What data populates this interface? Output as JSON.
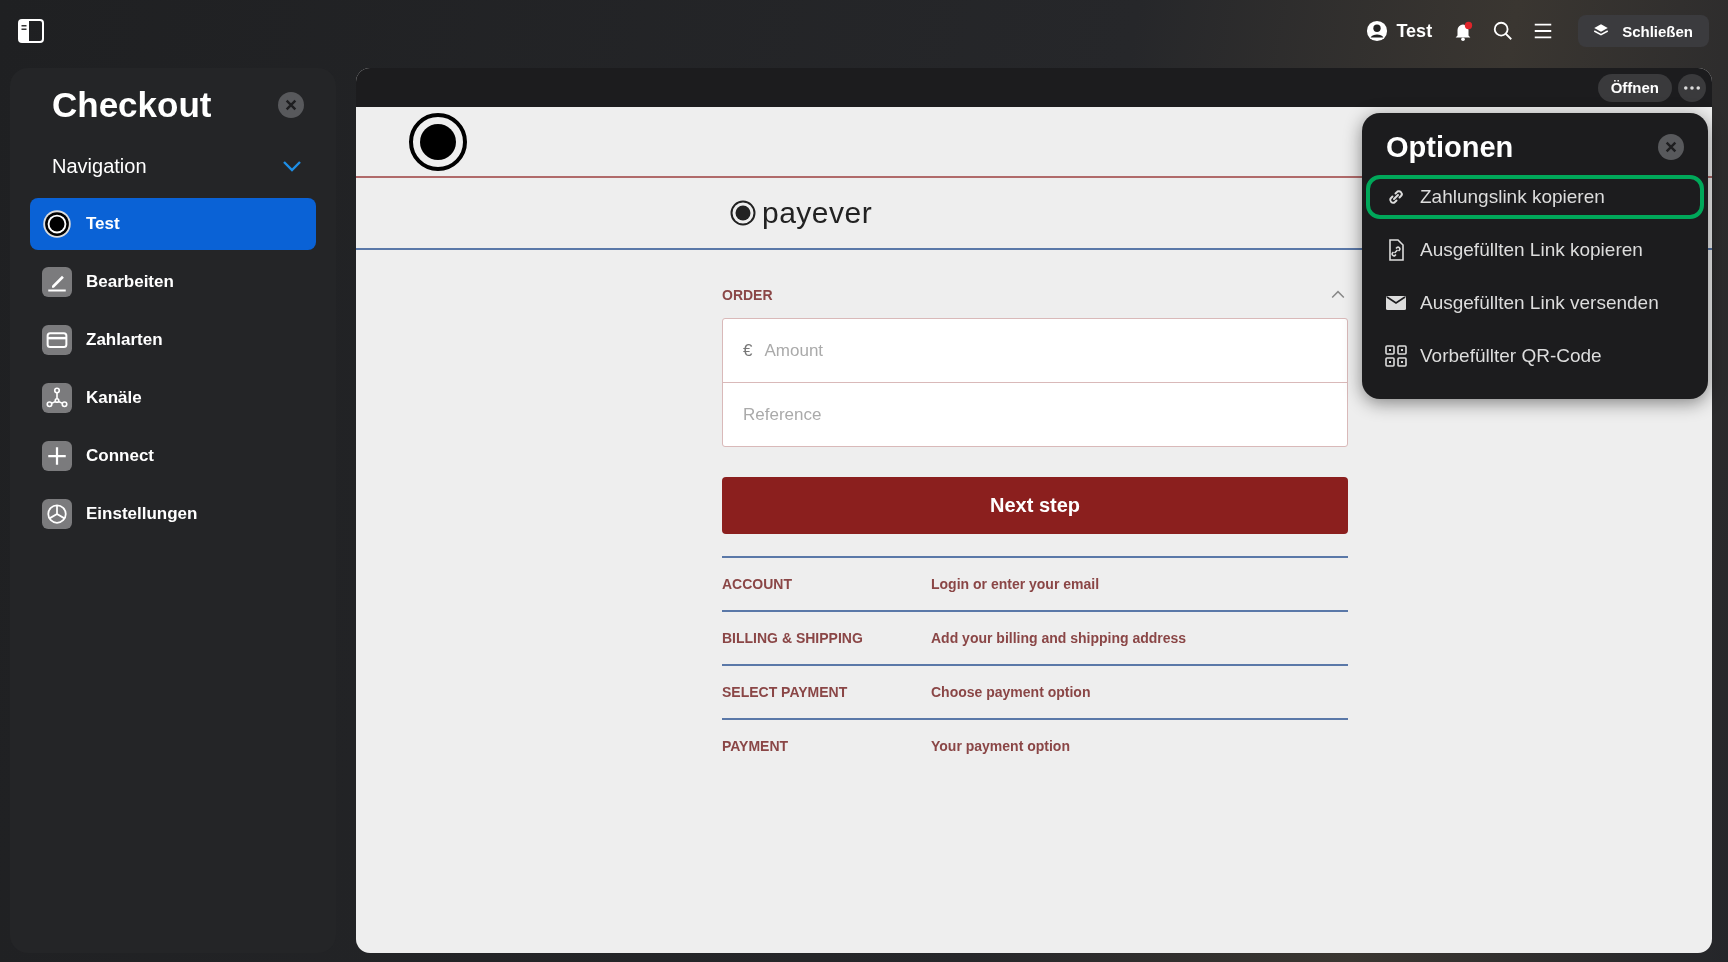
{
  "topbar": {
    "user": "Test",
    "close_button": "Schließen"
  },
  "sidebar": {
    "title": "Checkout",
    "section": "Navigation",
    "expanded": true,
    "items": [
      {
        "label": "Test",
        "kind": "logo",
        "selected": true
      },
      {
        "label": "Bearbeiten",
        "kind": "edit",
        "selected": false
      },
      {
        "label": "Zahlarten",
        "kind": "card",
        "selected": false
      },
      {
        "label": "Kanäle",
        "kind": "channels",
        "selected": false
      },
      {
        "label": "Connect",
        "kind": "plus",
        "selected": false
      },
      {
        "label": "Einstellungen",
        "kind": "settings",
        "selected": false
      }
    ]
  },
  "panel": {
    "open_button": "Öffnen",
    "brand": "payever",
    "order": {
      "title": "ORDER",
      "expanded": true,
      "currency": "€",
      "amount_placeholder": "Amount",
      "reference_placeholder": "Reference",
      "button": "Next step"
    },
    "steps": [
      {
        "title": "ACCOUNT",
        "description": "Login or enter your email"
      },
      {
        "title": "BILLING & SHIPPING",
        "description": "Add your billing and shipping address"
      },
      {
        "title": "SELECT PAYMENT",
        "description": "Choose payment option"
      },
      {
        "title": "PAYMENT",
        "description": "Your payment option"
      }
    ]
  },
  "options": {
    "title": "Optionen",
    "items": [
      {
        "label": "Zahlungslink kopieren",
        "kind": "link",
        "selected": true
      },
      {
        "label": "Ausgefüllten Link kopieren",
        "kind": "file-link",
        "selected": false
      },
      {
        "label": "Ausgefüllten Link versenden",
        "kind": "mail",
        "selected": false
      },
      {
        "label": "Vorbefüllter QR-Code",
        "kind": "qr",
        "selected": false
      }
    ]
  }
}
